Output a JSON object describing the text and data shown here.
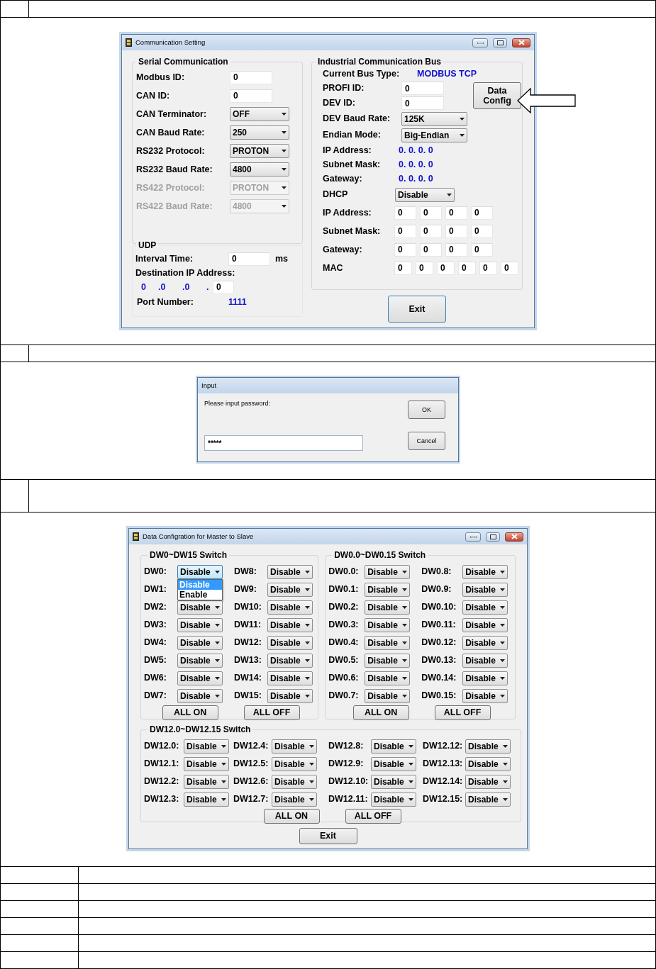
{
  "comm_window": {
    "title": "Communication Setting",
    "serial": {
      "title": "Serial Communication",
      "rows": [
        {
          "label": "Modbus ID:",
          "kind": "input",
          "value": "0",
          "disabled": false
        },
        {
          "label": "CAN ID:",
          "kind": "input",
          "value": "0",
          "disabled": false
        },
        {
          "label": "CAN Terminator:",
          "kind": "combo",
          "value": "OFF",
          "disabled": false
        },
        {
          "label": "CAN Baud Rate:",
          "kind": "combo",
          "value": "250",
          "disabled": false
        },
        {
          "label": "RS232 Protocol:",
          "kind": "combo",
          "value": "PROTON",
          "disabled": false
        },
        {
          "label": "RS232 Baud Rate:",
          "kind": "combo",
          "value": "4800",
          "disabled": false
        },
        {
          "label": "RS422 Protocol:",
          "kind": "combo",
          "value": "PROTON",
          "disabled": true
        },
        {
          "label": "RS422 Baud Rate:",
          "kind": "combo",
          "value": "4800",
          "disabled": true
        }
      ]
    },
    "udp": {
      "title": "UDP",
      "interval_label": "Interval Time:",
      "interval_value": "0",
      "interval_unit": "ms",
      "dest_label": "Destination IP Address:",
      "dest_ip": [
        "0",
        ".0",
        ".0",
        "."
      ],
      "dest_last": "0",
      "port_label": "Port Number:",
      "port_value": "1111"
    },
    "bus": {
      "title": "Industrial Communication Bus",
      "bus_type_label": "Current Bus Type:",
      "bus_type": "MODBUS TCP",
      "ids": [
        {
          "label": "PROFI ID:",
          "value": "0"
        },
        {
          "label": "DEV ID:",
          "value": "0"
        }
      ],
      "data_config_button": "Data Config",
      "combos": [
        {
          "label": "DEV Baud Rate:",
          "value": "125K"
        },
        {
          "label": "Endian Mode:",
          "value": "Big-Endian"
        }
      ],
      "readouts": [
        {
          "label": "IP Address:",
          "value": "0. 0. 0. 0"
        },
        {
          "label": "Subnet Mask:",
          "value": "0. 0. 0. 0"
        },
        {
          "label": "Gateway:",
          "value": "0. 0. 0. 0"
        }
      ],
      "dhcp": {
        "label": "DHCP",
        "value": "Disable"
      },
      "octet_rows": [
        {
          "label": "IP Address:",
          "values": [
            "0",
            "0",
            "0",
            "0"
          ]
        },
        {
          "label": "Subnet Mask:",
          "values": [
            "0",
            "0",
            "0",
            "0"
          ]
        },
        {
          "label": "Gateway:",
          "values": [
            "0",
            "0",
            "0",
            "0"
          ]
        },
        {
          "label": "MAC",
          "values": [
            "0",
            "0",
            "0",
            "0",
            "0",
            "0"
          ]
        }
      ]
    },
    "exit_button": "Exit"
  },
  "input_dialog": {
    "title": "Input",
    "prompt": "Please input password:",
    "value": "*****",
    "buttons": [
      "OK",
      "Cancel"
    ]
  },
  "data_window": {
    "title": "Data Configration for Master to Slave",
    "groups": [
      {
        "title": "DW0~DW15 Switch",
        "columns": [
          [
            {
              "label": "DW0:",
              "value": "Disable",
              "dropdown": {
                "options": [
                  {
                    "label": "Disable",
                    "selected": true
                  },
                  {
                    "label": "Enable",
                    "selected": false
                  }
                ]
              }
            },
            {
              "label": "DW1:"
            },
            {
              "label": "DW2:",
              "value": "Disable"
            },
            {
              "label": "DW3:",
              "value": "Disable"
            },
            {
              "label": "DW4:",
              "value": "Disable"
            },
            {
              "label": "DW5:",
              "value": "Disable"
            },
            {
              "label": "DW6:",
              "value": "Disable"
            },
            {
              "label": "DW7:",
              "value": "Disable"
            }
          ],
          [
            {
              "label": "DW8:",
              "value": "Disable"
            },
            {
              "label": "DW9:",
              "value": "Disable"
            },
            {
              "label": "DW10:",
              "value": "Disable"
            },
            {
              "label": "DW11:",
              "value": "Disable"
            },
            {
              "label": "DW12:",
              "value": "Disable"
            },
            {
              "label": "DW13:",
              "value": "Disable"
            },
            {
              "label": "DW14:",
              "value": "Disable"
            },
            {
              "label": "DW15:",
              "value": "Disable"
            }
          ]
        ],
        "buttons": [
          "ALL ON",
          "ALL OFF"
        ]
      },
      {
        "title": "DW0.0~DW0.15 Switch",
        "columns": [
          [
            {
              "label": "DW0.0:",
              "value": "Disable"
            },
            {
              "label": "DW0.1:",
              "value": "Disable"
            },
            {
              "label": "DW0.2:",
              "value": "Disable"
            },
            {
              "label": "DW0.3:",
              "value": "Disable"
            },
            {
              "label": "DW0.4:",
              "value": "Disable"
            },
            {
              "label": "DW0.5:",
              "value": "Disable"
            },
            {
              "label": "DW0.6:",
              "value": "Disable"
            },
            {
              "label": "DW0.7:",
              "value": "Disable"
            }
          ],
          [
            {
              "label": "DW0.8:",
              "value": "Disable"
            },
            {
              "label": "DW0.9:",
              "value": "Disable"
            },
            {
              "label": "DW0.10:",
              "value": "Disable"
            },
            {
              "label": "DW0.11:",
              "value": "Disable"
            },
            {
              "label": "DW0.12:",
              "value": "Disable"
            },
            {
              "label": "DW0.13:",
              "value": "Disable"
            },
            {
              "label": "DW0.14:",
              "value": "Disable"
            },
            {
              "label": "DW0.15:",
              "value": "Disable"
            }
          ]
        ],
        "buttons": [
          "ALL ON",
          "ALL OFF"
        ]
      },
      {
        "title": "DW12.0~DW12.15 Switch",
        "columns": [
          [
            {
              "label": "DW12.0:",
              "value": "Disable"
            },
            {
              "label": "DW12.1:",
              "value": "Disable"
            },
            {
              "label": "DW12.2:",
              "value": "Disable"
            },
            {
              "label": "DW12.3:",
              "value": "Disable"
            }
          ],
          [
            {
              "label": "DW12.4:",
              "value": "Disable"
            },
            {
              "label": "DW12.5:",
              "value": "Disable"
            },
            {
              "label": "DW12.6:",
              "value": "Disable"
            },
            {
              "label": "DW12.7:",
              "value": "Disable"
            }
          ],
          [
            {
              "label": "DW12.8:",
              "value": "Disable"
            },
            {
              "label": "DW12.9:",
              "value": "Disable"
            },
            {
              "label": "DW12.10:",
              "value": "Disable"
            },
            {
              "label": "DW12.11:",
              "value": "Disable"
            }
          ],
          [
            {
              "label": "DW12.12:",
              "value": "Disable"
            },
            {
              "label": "DW12.13:",
              "value": "Disable"
            },
            {
              "label": "DW12.14:",
              "value": "Disable"
            },
            {
              "label": "DW12.15:",
              "value": "Disable"
            }
          ]
        ],
        "buttons": [
          "ALL ON",
          "ALL OFF"
        ]
      }
    ],
    "exit_button": "Exit"
  }
}
